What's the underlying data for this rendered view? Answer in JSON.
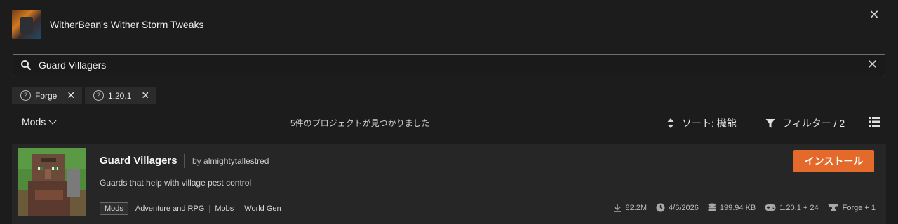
{
  "header": {
    "modpack_title": "WitherBean's Wither Storm Tweaks",
    "close_glyph": "✕"
  },
  "search": {
    "value": "Guard Villagers",
    "clear_glyph": "✕"
  },
  "filters": {
    "chips": [
      {
        "label": "Forge",
        "help_glyph": "?",
        "remove_glyph": "✕"
      },
      {
        "label": "1.20.1",
        "help_glyph": "?",
        "remove_glyph": "✕"
      }
    ]
  },
  "toolbar": {
    "category": "Mods",
    "results_count": "5件のプロジェクトが見つかりました",
    "sort_label": "ソート: 機能",
    "filter_label": "フィルター / 2"
  },
  "result": {
    "name": "Guard Villagers",
    "by_prefix": "by",
    "author": "almightytallestred",
    "install_label": "インストール",
    "description": "Guards that help with village pest control",
    "primary_tag": "Mods",
    "tags": [
      "Adventure and RPG",
      "Mobs",
      "World Gen"
    ],
    "downloads": "82.2M",
    "updated": "4/6/2026",
    "size": "199.94 KB",
    "game_versions": "1.20.1 + 24",
    "loaders": "Forge + 1"
  },
  "colors": {
    "background": "#1c1c1c",
    "card": "#262626",
    "accent": "#e46a2b"
  }
}
